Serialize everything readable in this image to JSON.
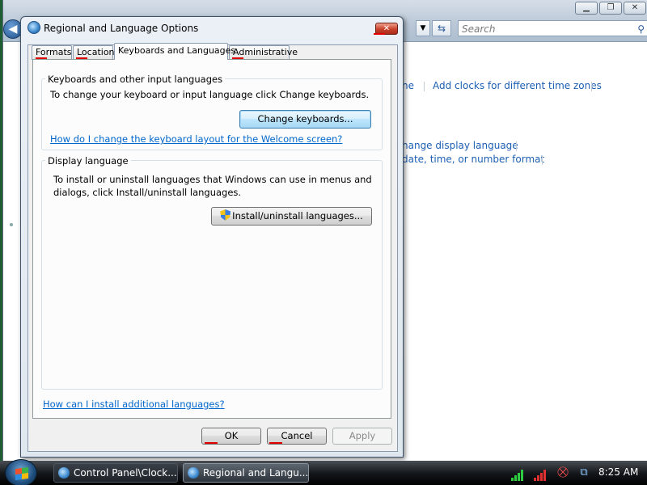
{
  "background_window": {
    "search_placeholder": "Search",
    "links": [
      "ne",
      "Add clocks for different time zones",
      "hange display language",
      " date, time, or number format"
    ]
  },
  "dialog": {
    "title": "Regional and Language Options",
    "tabs": [
      {
        "label": "Formats",
        "active": false
      },
      {
        "label": "Location",
        "active": false
      },
      {
        "label": "Keyboards and Languages",
        "active": true
      },
      {
        "label": "Administrative",
        "active": false
      }
    ],
    "keyboards_group": {
      "title": "Keyboards and other input languages",
      "description": "To change your keyboard or input language click Change keyboards.",
      "button": "Change keyboards...",
      "link": "How do I change the keyboard layout for the Welcome screen?"
    },
    "display_group": {
      "title": "Display language",
      "description_line1": "To install or uninstall languages that Windows can use in menus and",
      "description_line2": "dialogs, click Install/uninstall languages.",
      "button": "Install/uninstall languages..."
    },
    "bottom_link": "How can I install additional languages?",
    "buttons": {
      "ok": "OK",
      "cancel": "Cancel",
      "apply": "Apply"
    }
  },
  "taskbar": {
    "tasks": [
      {
        "label": "Control Panel\\Clock...",
        "active": false
      },
      {
        "label": "Regional and Langu...",
        "active": true
      }
    ],
    "clock": "8:25 AM"
  },
  "colors": {
    "link": "#0066cc",
    "annotation_underline": "#e00000"
  }
}
